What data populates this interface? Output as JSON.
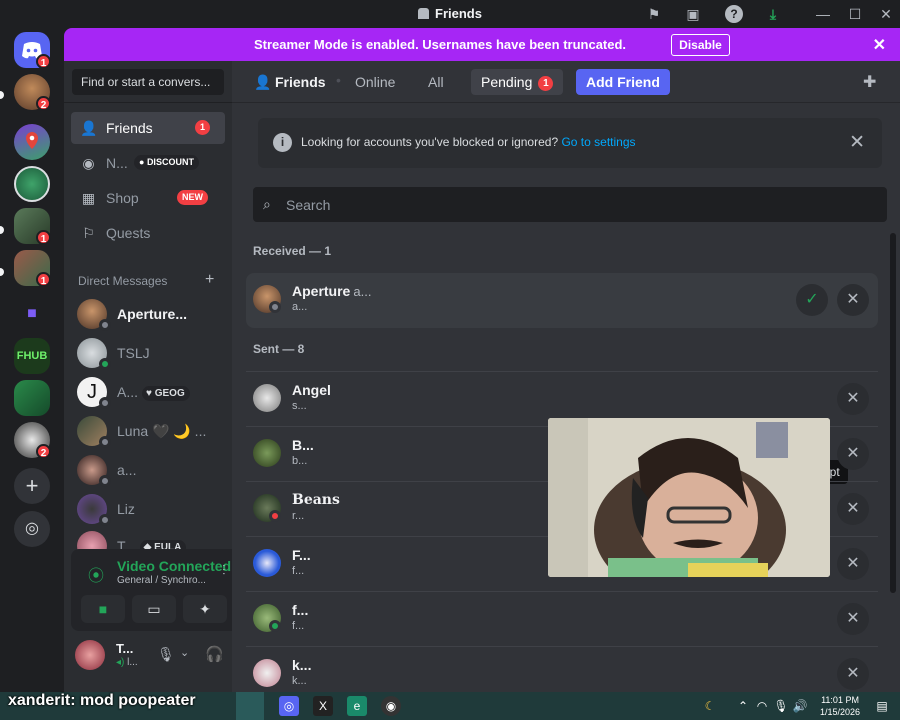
{
  "window": {
    "title": "Friends",
    "controls": [
      "—",
      "☐",
      "✕"
    ]
  },
  "banner": {
    "text": "Streamer Mode is enabled. Usernames have been truncated.",
    "button": "Disable"
  },
  "servers": {
    "home_badge": "1",
    "badges": [
      "2",
      "1",
      "1",
      "2"
    ]
  },
  "sidebar": {
    "search_placeholder": "Find or start a convers...",
    "nav": [
      {
        "label": "Friends",
        "badge": "1"
      },
      {
        "label": "N...",
        "tag": "DISCOUNT"
      },
      {
        "label": "Shop",
        "tag": "NEW"
      },
      {
        "label": "Quests"
      }
    ],
    "dm_header": "Direct Messages",
    "dms": [
      {
        "name": "Aperture..."
      },
      {
        "name": "TSLJ"
      },
      {
        "name": "A...",
        "tag": "GEOG"
      },
      {
        "name": "Luna 🖤 🌙 ..."
      },
      {
        "name": "a..."
      },
      {
        "name": "Liz"
      },
      {
        "name": "T...",
        "tag": "EULA"
      }
    ]
  },
  "voice": {
    "status": "Video Connected",
    "channel": "General / Synchro..."
  },
  "user": {
    "name": "T...",
    "sub": "l..."
  },
  "main": {
    "header": {
      "title": "Friends",
      "tabs": [
        "Online",
        "All",
        "Pending"
      ],
      "pending_badge": "1",
      "add_friend": "Add Friend"
    },
    "notice": {
      "text": "Looking for accounts you've blocked or ignored?",
      "link": "Go to settings"
    },
    "search_placeholder": "Search",
    "received_label": "Received — 1",
    "received": [
      {
        "name": "Aperture",
        "tag": "a...",
        "sub": "a..."
      }
    ],
    "tooltip": "Accept",
    "sent_label": "Sent — 8",
    "sent": [
      {
        "name": "Angel",
        "sub": "s..."
      },
      {
        "name": "B...",
        "sub": "b..."
      },
      {
        "name": "Beans",
        "sub": "r..."
      },
      {
        "name": "F...",
        "sub": "f..."
      },
      {
        "name": "f...",
        "sub": "f..."
      },
      {
        "name": "k...",
        "sub": "k..."
      }
    ]
  },
  "overlay": {
    "text": "xanderit: mod poopeater"
  },
  "taskbar": {
    "time": "11:01 PM",
    "date": "1/15/2026"
  }
}
